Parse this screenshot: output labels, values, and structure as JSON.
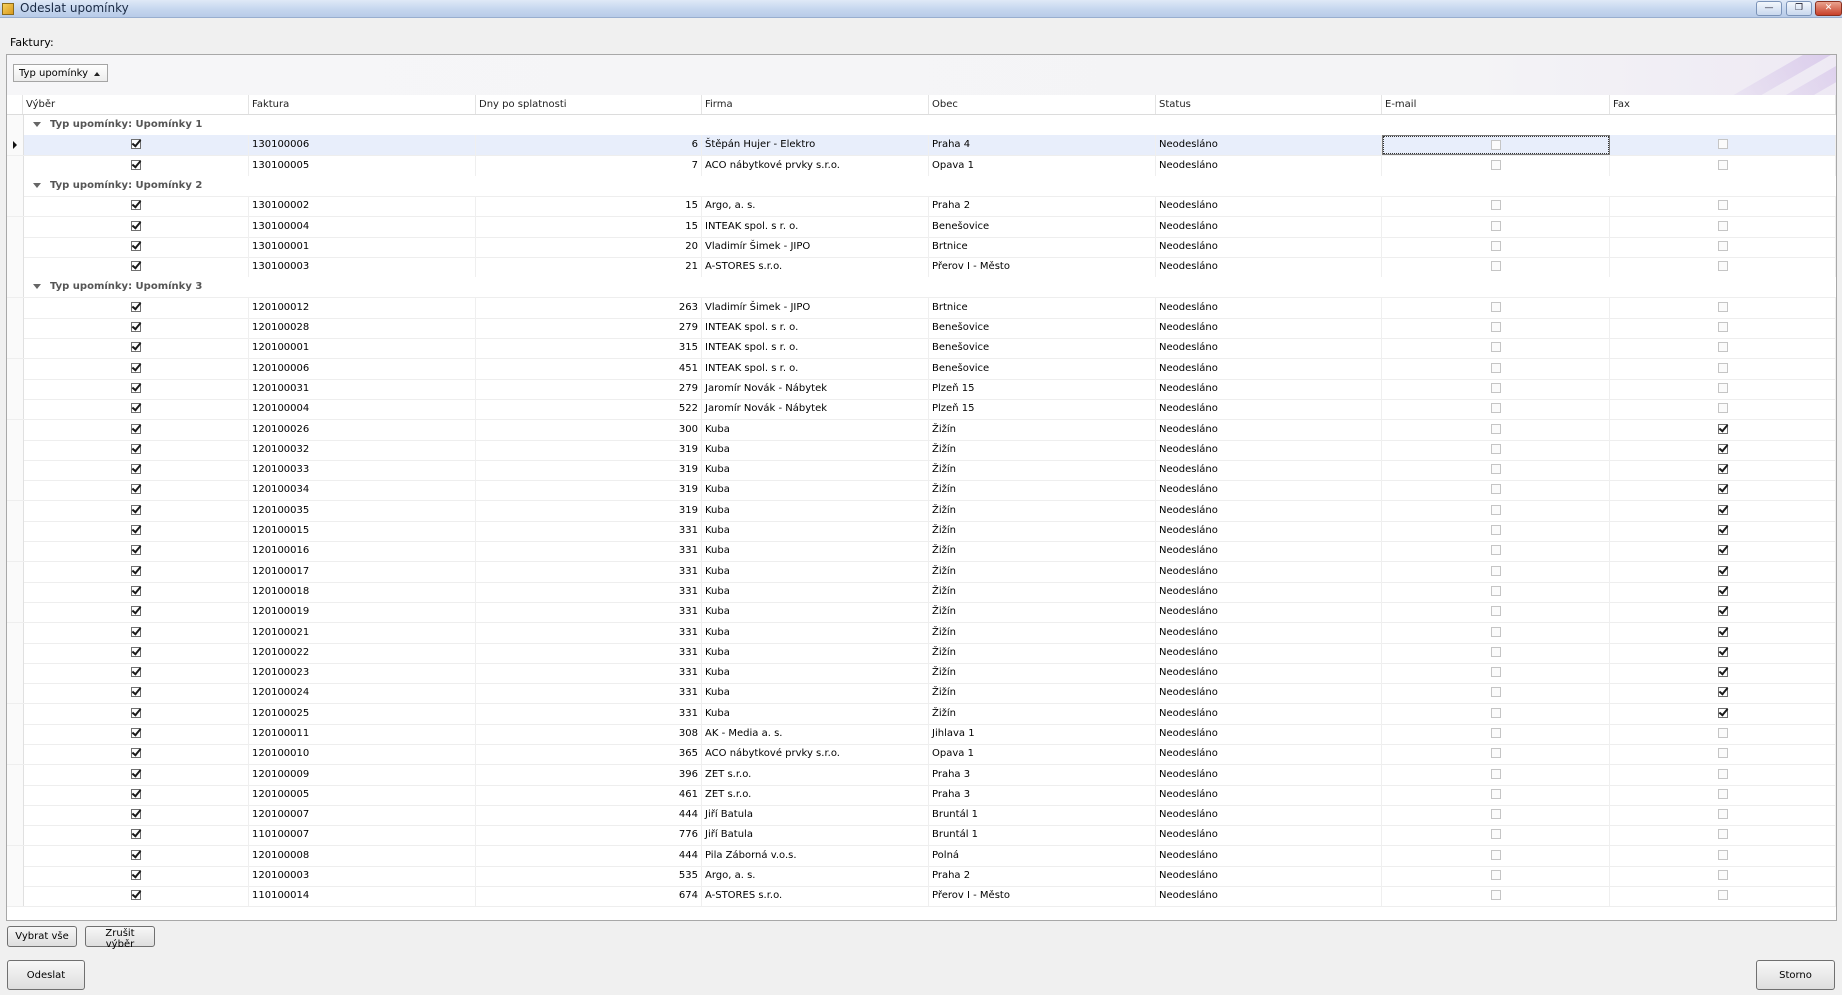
{
  "window": {
    "title": "Odeslat upomínky",
    "minimize": "—",
    "maximize": "❐",
    "close": "✕"
  },
  "faktury_label": "Faktury:",
  "group_chip": "Typ upomínky",
  "columns": [
    "Výběr",
    "Faktura",
    "Dny po splatnosti",
    "Firma",
    "Obec",
    "Status",
    "E-mail",
    "Fax"
  ],
  "groups": [
    {
      "label": "Typ upomínky: Upomínky 1",
      "rows": [
        {
          "faktura": "130100006",
          "dny": "6",
          "firma": "Štěpán Hujer - Elektro",
          "obec": "Praha 4",
          "status": "Neodesláno",
          "vyber": true,
          "email": false,
          "fax": false
        },
        {
          "faktura": "130100005",
          "dny": "7",
          "firma": "ACO nábytkové prvky s.r.o.",
          "obec": "Opava 1",
          "status": "Neodesláno",
          "vyber": true,
          "email": false,
          "fax": false
        }
      ]
    },
    {
      "label": "Typ upomínky: Upomínky 2",
      "rows": [
        {
          "faktura": "130100002",
          "dny": "15",
          "firma": "Argo, a. s.",
          "obec": "Praha 2",
          "status": "Neodesláno",
          "vyber": true,
          "email": false,
          "fax": false
        },
        {
          "faktura": "130100004",
          "dny": "15",
          "firma": "INTEAK spol. s r. o.",
          "obec": "Benešovice",
          "status": "Neodesláno",
          "vyber": true,
          "email": false,
          "fax": false
        },
        {
          "faktura": "130100001",
          "dny": "20",
          "firma": "Vladimír Šimek - JIPO",
          "obec": "Brtnice",
          "status": "Neodesláno",
          "vyber": true,
          "email": false,
          "fax": false
        },
        {
          "faktura": "130100003",
          "dny": "21",
          "firma": "A-STORES s.r.o.",
          "obec": "Přerov I - Město",
          "status": "Neodesláno",
          "vyber": true,
          "email": false,
          "fax": false
        }
      ]
    },
    {
      "label": "Typ upomínky: Upomínky 3",
      "rows": [
        {
          "faktura": "120100012",
          "dny": "263",
          "firma": "Vladimír Šimek - JIPO",
          "obec": "Brtnice",
          "status": "Neodesláno",
          "vyber": true,
          "email": false,
          "fax": false
        },
        {
          "faktura": "120100028",
          "dny": "279",
          "firma": "INTEAK spol. s r. o.",
          "obec": "Benešovice",
          "status": "Neodesláno",
          "vyber": true,
          "email": false,
          "fax": false
        },
        {
          "faktura": "120100001",
          "dny": "315",
          "firma": "INTEAK spol. s r. o.",
          "obec": "Benešovice",
          "status": "Neodesláno",
          "vyber": true,
          "email": false,
          "fax": false
        },
        {
          "faktura": "120100006",
          "dny": "451",
          "firma": "INTEAK spol. s r. o.",
          "obec": "Benešovice",
          "status": "Neodesláno",
          "vyber": true,
          "email": false,
          "fax": false
        },
        {
          "faktura": "120100031",
          "dny": "279",
          "firma": "Jaromír Novák - Nábytek",
          "obec": "Plzeň 15",
          "status": "Neodesláno",
          "vyber": true,
          "email": false,
          "fax": false
        },
        {
          "faktura": "120100004",
          "dny": "522",
          "firma": "Jaromír Novák - Nábytek",
          "obec": "Plzeň 15",
          "status": "Neodesláno",
          "vyber": true,
          "email": false,
          "fax": false
        },
        {
          "faktura": "120100026",
          "dny": "300",
          "firma": "Kuba",
          "obec": "Žižín",
          "status": "Neodesláno",
          "vyber": true,
          "email": false,
          "fax": true
        },
        {
          "faktura": "120100032",
          "dny": "319",
          "firma": "Kuba",
          "obec": "Žižín",
          "status": "Neodesláno",
          "vyber": true,
          "email": false,
          "fax": true
        },
        {
          "faktura": "120100033",
          "dny": "319",
          "firma": "Kuba",
          "obec": "Žižín",
          "status": "Neodesláno",
          "vyber": true,
          "email": false,
          "fax": true
        },
        {
          "faktura": "120100034",
          "dny": "319",
          "firma": "Kuba",
          "obec": "Žižín",
          "status": "Neodesláno",
          "vyber": true,
          "email": false,
          "fax": true
        },
        {
          "faktura": "120100035",
          "dny": "319",
          "firma": "Kuba",
          "obec": "Žižín",
          "status": "Neodesláno",
          "vyber": true,
          "email": false,
          "fax": true
        },
        {
          "faktura": "120100015",
          "dny": "331",
          "firma": "Kuba",
          "obec": "Žižín",
          "status": "Neodesláno",
          "vyber": true,
          "email": false,
          "fax": true
        },
        {
          "faktura": "120100016",
          "dny": "331",
          "firma": "Kuba",
          "obec": "Žižín",
          "status": "Neodesláno",
          "vyber": true,
          "email": false,
          "fax": true
        },
        {
          "faktura": "120100017",
          "dny": "331",
          "firma": "Kuba",
          "obec": "Žižín",
          "status": "Neodesláno",
          "vyber": true,
          "email": false,
          "fax": true
        },
        {
          "faktura": "120100018",
          "dny": "331",
          "firma": "Kuba",
          "obec": "Žižín",
          "status": "Neodesláno",
          "vyber": true,
          "email": false,
          "fax": true
        },
        {
          "faktura": "120100019",
          "dny": "331",
          "firma": "Kuba",
          "obec": "Žižín",
          "status": "Neodesláno",
          "vyber": true,
          "email": false,
          "fax": true
        },
        {
          "faktura": "120100021",
          "dny": "331",
          "firma": "Kuba",
          "obec": "Žižín",
          "status": "Neodesláno",
          "vyber": true,
          "email": false,
          "fax": true
        },
        {
          "faktura": "120100022",
          "dny": "331",
          "firma": "Kuba",
          "obec": "Žižín",
          "status": "Neodesláno",
          "vyber": true,
          "email": false,
          "fax": true
        },
        {
          "faktura": "120100023",
          "dny": "331",
          "firma": "Kuba",
          "obec": "Žižín",
          "status": "Neodesláno",
          "vyber": true,
          "email": false,
          "fax": true
        },
        {
          "faktura": "120100024",
          "dny": "331",
          "firma": "Kuba",
          "obec": "Žižín",
          "status": "Neodesláno",
          "vyber": true,
          "email": false,
          "fax": true
        },
        {
          "faktura": "120100025",
          "dny": "331",
          "firma": "Kuba",
          "obec": "Žižín",
          "status": "Neodesláno",
          "vyber": true,
          "email": false,
          "fax": true
        },
        {
          "faktura": "120100011",
          "dny": "308",
          "firma": "AK - Media a. s.",
          "obec": "Jihlava 1",
          "status": "Neodesláno",
          "vyber": true,
          "email": false,
          "fax": false
        },
        {
          "faktura": "120100010",
          "dny": "365",
          "firma": "ACO nábytkové prvky s.r.o.",
          "obec": "Opava 1",
          "status": "Neodesláno",
          "vyber": true,
          "email": false,
          "fax": false
        },
        {
          "faktura": "120100009",
          "dny": "396",
          "firma": "ZET s.r.o.",
          "obec": "Praha 3",
          "status": "Neodesláno",
          "vyber": true,
          "email": false,
          "fax": false
        },
        {
          "faktura": "120100005",
          "dny": "461",
          "firma": "ZET s.r.o.",
          "obec": "Praha 3",
          "status": "Neodesláno",
          "vyber": true,
          "email": false,
          "fax": false
        },
        {
          "faktura": "120100007",
          "dny": "444",
          "firma": "Jiří Batula",
          "obec": "Bruntál 1",
          "status": "Neodesláno",
          "vyber": true,
          "email": false,
          "fax": false
        },
        {
          "faktura": "110100007",
          "dny": "776",
          "firma": "Jiří Batula",
          "obec": "Bruntál 1",
          "status": "Neodesláno",
          "vyber": true,
          "email": false,
          "fax": false
        },
        {
          "faktura": "120100008",
          "dny": "444",
          "firma": "Pila Záborná v.o.s.",
          "obec": "Polná",
          "status": "Neodesláno",
          "vyber": true,
          "email": false,
          "fax": false
        },
        {
          "faktura": "120100003",
          "dny": "535",
          "firma": "Argo, a. s.",
          "obec": "Praha 2",
          "status": "Neodesláno",
          "vyber": true,
          "email": false,
          "fax": false
        },
        {
          "faktura": "110100014",
          "dny": "674",
          "firma": "A-STORES s.r.o.",
          "obec": "Přerov I - Město",
          "status": "Neodesláno",
          "vyber": true,
          "email": false,
          "fax": false
        }
      ]
    }
  ],
  "buttons": {
    "select_all": "Vybrat vše",
    "clear_selection": "Zrušit výběr",
    "send": "Odeslat",
    "cancel": "Storno"
  }
}
